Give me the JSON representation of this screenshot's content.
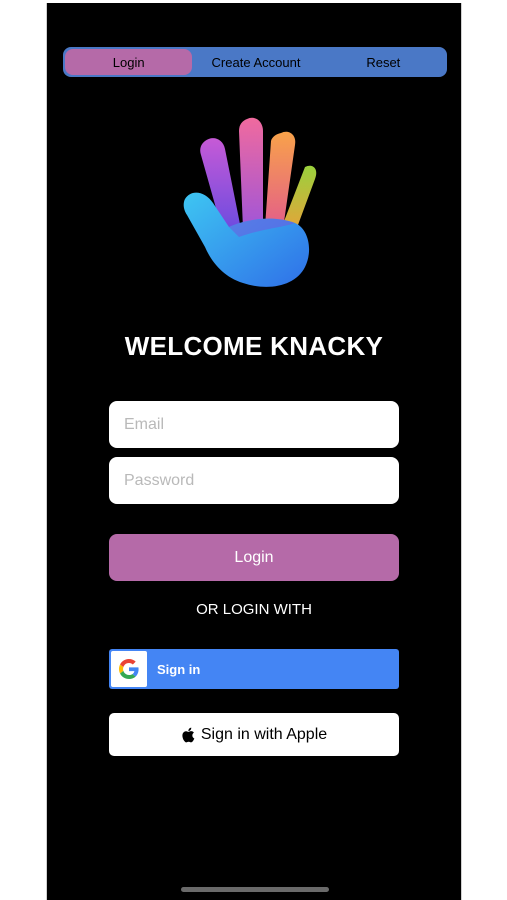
{
  "tabs": [
    {
      "label": "Login",
      "active": true
    },
    {
      "label": "Create Account",
      "active": false
    },
    {
      "label": "Reset",
      "active": false
    }
  ],
  "welcome_title": "WELCOME KNACKY",
  "form": {
    "email_placeholder": "Email",
    "password_placeholder": "Password",
    "email_value": "",
    "password_value": ""
  },
  "login_button_label": "Login",
  "alt_login_text": "OR LOGIN WITH",
  "google_button_label": "Sign in",
  "apple_button_label": "Sign in with Apple",
  "icons": {
    "logo": "colorful-hand-logo-icon",
    "google": "google-g-icon",
    "apple": "apple-icon"
  },
  "colors": {
    "background": "#000000",
    "accent_pink": "#b56aa8",
    "segment_blue": "#4a78c6",
    "google_blue": "#4485f4"
  }
}
